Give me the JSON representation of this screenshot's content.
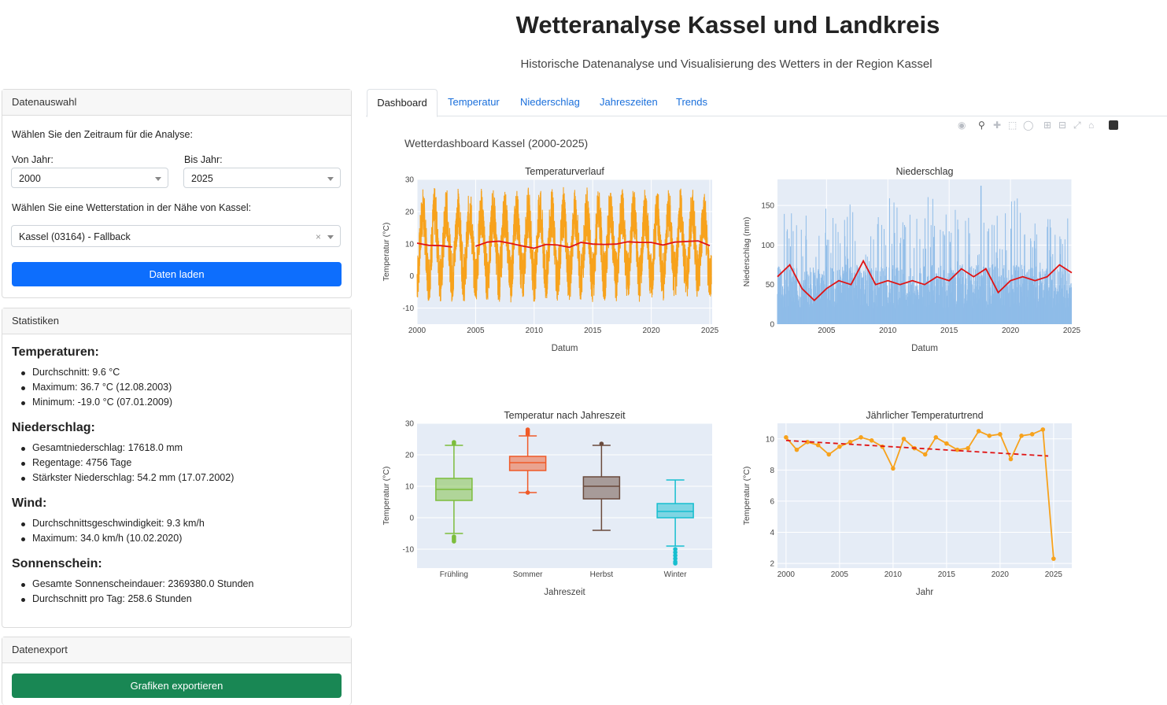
{
  "header": {
    "title": "Wetteranalyse Kassel und Landkreis",
    "subtitle": "Historische Datenanalyse und Visualisierung des Wetters in der Region Kassel"
  },
  "data_selection": {
    "header": "Datenauswahl",
    "prompt": "Wählen Sie den Zeitraum für die Analyse:",
    "from_label": "Von Jahr:",
    "from_value": "2000",
    "to_label": "Bis Jahr:",
    "to_value": "2025",
    "station_prompt": "Wählen Sie eine Wetterstation in der Nähe von Kassel:",
    "station_value": "Kassel (03164) - Fallback",
    "load_button": "Daten laden"
  },
  "statistics": {
    "header": "Statistiken",
    "sections": [
      {
        "title": "Temperaturen:",
        "items": [
          "Durchschnitt: 9.6 °C",
          "Maximum: 36.7 °C (12.08.2003)",
          "Minimum: -19.0 °C (07.01.2009)"
        ]
      },
      {
        "title": "Niederschlag:",
        "items": [
          "Gesamtniederschlag: 17618.0 mm",
          "Regentage: 4756 Tage",
          "Stärkster Niederschlag: 54.2 mm (17.07.2002)"
        ]
      },
      {
        "title": "Wind:",
        "items": [
          "Durchschnittsgeschwindigkeit: 9.3 km/h",
          "Maximum: 34.0 km/h (10.02.2020)"
        ]
      },
      {
        "title": "Sonnenschein:",
        "items": [
          "Gesamte Sonnenscheindauer: 2369380.0 Stunden",
          "Durchschnitt pro Tag: 258.6 Stunden"
        ]
      }
    ]
  },
  "export": {
    "header": "Datenexport",
    "button": "Grafiken exportieren"
  },
  "tabs": [
    "Dashboard",
    "Temperatur",
    "Niederschlag",
    "Jahreszeiten",
    "Trends"
  ],
  "colors": {
    "primary": "#0d6efd",
    "success": "#198754",
    "plot_bg": "#e5ecf6",
    "temperature": "#f7a21c",
    "rolling": "#e01414",
    "precip_bar": "#8fbce8"
  },
  "dashboard_title": "Wetterdashboard Kassel (2000-2025)",
  "chart_data": [
    {
      "type": "line",
      "title": "Temperaturverlauf",
      "xlabel": "Datum",
      "ylabel": "Temperatur (°C)",
      "xlim": [
        2000,
        2025.2
      ],
      "ylim": [
        -15,
        30
      ],
      "xticks": [
        2000,
        2005,
        2010,
        2015,
        2020,
        2025
      ],
      "yticks": [
        -10,
        0,
        10,
        20,
        30
      ],
      "series": [
        {
          "name": "",
          "style": "seasonal daily temperature",
          "mean": 9.6,
          "amplitude": 10,
          "years": [
            2000,
            2025
          ]
        },
        {
          "name": "",
          "style": "rolling mean",
          "x": [
            2000,
            2001,
            2002,
            2003,
            2004,
            2005,
            2006,
            2007,
            2008,
            2009,
            2010,
            2011,
            2012,
            2013,
            2014,
            2015,
            2016,
            2017,
            2018,
            2019,
            2020,
            2021,
            2022,
            2023,
            2024,
            2025
          ],
          "values": [
            10.2,
            9.5,
            9.4,
            9.0,
            null,
            9.2,
            10.5,
            10.8,
            10.1,
            9.3,
            8.6,
            9.8,
            9.6,
            8.9,
            10.4,
            9.9,
            9.8,
            9.9,
            10.6,
            10.4,
            10.4,
            9.6,
            10.5,
            10.7,
            10.9,
            9.4
          ]
        }
      ]
    },
    {
      "type": "bar",
      "title": "Niederschlag",
      "xlabel": "Datum",
      "ylabel": "Niederschlag (mm)",
      "xlim": [
        2001,
        2025
      ],
      "ylim": [
        0,
        183
      ],
      "xticks": [
        2005,
        2010,
        2015,
        2020,
        2025
      ],
      "yticks": [
        0,
        50,
        100,
        150
      ],
      "series": [
        {
          "name": "",
          "style": "rolling mean",
          "x": [
            2001,
            2002,
            2003,
            2004,
            2005,
            2006,
            2007,
            2008,
            2009,
            2010,
            2011,
            2012,
            2013,
            2014,
            2015,
            2016,
            2017,
            2018,
            2019,
            2020,
            2021,
            2022,
            2023,
            2024,
            2025
          ],
          "values": [
            60,
            75,
            45,
            30,
            45,
            55,
            50,
            80,
            50,
            55,
            50,
            55,
            50,
            60,
            55,
            70,
            60,
            70,
            40,
            55,
            60,
            55,
            60,
            75,
            65
          ]
        }
      ]
    },
    {
      "type": "box",
      "title": "Temperatur nach Jahreszeit",
      "xlabel": "Jahreszeit",
      "ylabel": "Temperatur (°C)",
      "ylim": [
        -16,
        30
      ],
      "yticks": [
        -10,
        0,
        10,
        20,
        30
      ],
      "categories": [
        "Frühling",
        "Sommer",
        "Herbst",
        "Winter"
      ],
      "colors": [
        "#7cbd3c",
        "#f05a28",
        "#6a4a3c",
        "#17becf"
      ],
      "boxes": [
        {
          "lowerfence": -5,
          "q1": 5.5,
          "median": 9,
          "q3": 12.5,
          "upperfence": 23,
          "outliers": [
            -6,
            -6.5,
            -7,
            -7.5,
            23.5,
            24
          ]
        },
        {
          "lowerfence": 8,
          "q1": 15,
          "median": 17.5,
          "q3": 19.5,
          "upperfence": 26,
          "outliers": [
            26.5,
            27,
            27.5,
            28,
            8
          ]
        },
        {
          "lowerfence": -4,
          "q1": 6,
          "median": 10,
          "q3": 13,
          "upperfence": 23,
          "outliers": [
            23.5
          ]
        },
        {
          "lowerfence": -9,
          "q1": 0,
          "median": 2,
          "q3": 4.5,
          "upperfence": 12,
          "outliers": [
            -10,
            -11,
            -12,
            -13,
            -14,
            -14.5
          ]
        }
      ]
    },
    {
      "type": "line",
      "title": "Jährlicher Temperaturtrend",
      "xlabel": "Jahr",
      "ylabel": "Temperatur (°C)",
      "xlim": [
        1999.2,
        2026.7
      ],
      "ylim": [
        1.7,
        11
      ],
      "xticks": [
        2000,
        2005,
        2010,
        2015,
        2020,
        2025
      ],
      "yticks": [
        2,
        4,
        6,
        8,
        10
      ],
      "x": [
        2000,
        2001,
        2002,
        2003,
        2004,
        2005,
        2006,
        2007,
        2008,
        2009,
        2010,
        2011,
        2012,
        2013,
        2014,
        2015,
        2016,
        2017,
        2018,
        2019,
        2020,
        2021,
        2022,
        2023,
        2024,
        2025
      ],
      "values": [
        10.1,
        9.3,
        9.8,
        9.6,
        9.0,
        9.5,
        9.8,
        10.1,
        9.9,
        9.5,
        8.1,
        10.0,
        9.4,
        9.0,
        10.1,
        9.7,
        9.3,
        9.4,
        10.5,
        10.2,
        10.3,
        8.7,
        10.2,
        10.3,
        10.6,
        2.3
      ],
      "trend": {
        "x": [
          2000,
          2024.5
        ],
        "values": [
          9.9,
          8.9
        ]
      }
    }
  ]
}
